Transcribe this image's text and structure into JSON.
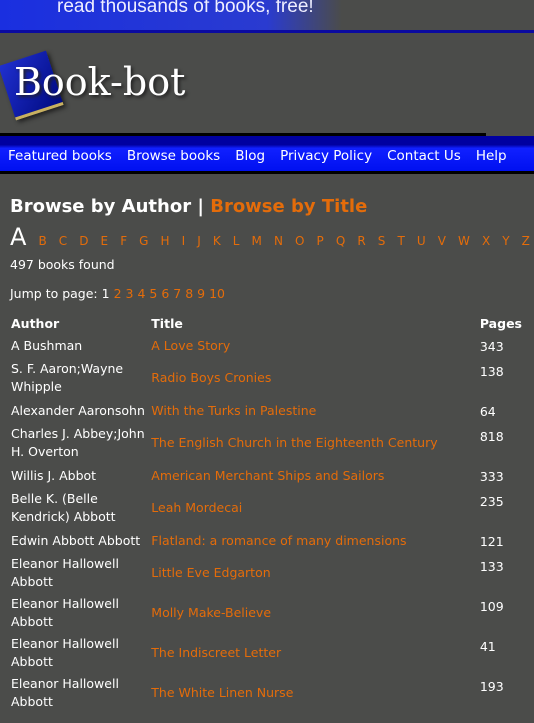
{
  "banner": {
    "tagline": "read thousands of books, free!"
  },
  "logo": {
    "text": "Book-bot"
  },
  "nav": [
    "Featured books",
    "Browse books",
    "Blog",
    "Privacy Policy",
    "Contact Us",
    "Help"
  ],
  "heading": {
    "author": "Browse by Author",
    "sep": "|",
    "title": "Browse by Title"
  },
  "alphabet": {
    "current": "A",
    "letters": [
      "B",
      "C",
      "D",
      "E",
      "F",
      "G",
      "H",
      "I",
      "J",
      "K",
      "L",
      "M",
      "N",
      "O",
      "P",
      "Q",
      "R",
      "S",
      "T",
      "U",
      "V",
      "W",
      "X",
      "Y",
      "Z"
    ]
  },
  "found": "497 books found",
  "jump": {
    "label": "Jump to page:",
    "current": "1",
    "pages": [
      "2",
      "3",
      "4",
      "5",
      "6",
      "7",
      "8",
      "9",
      "10"
    ]
  },
  "colors": {
    "background": "#4b4c4a",
    "accent": "#e46c0a",
    "nav": "#0010f0"
  },
  "table": {
    "headers": [
      "Author",
      "Title",
      "Pages"
    ],
    "rows": [
      {
        "author": "A Bushman",
        "title": "A Love Story",
        "pages": "343"
      },
      {
        "author": "S. F. Aaron;Wayne Whipple",
        "title": "Radio Boys Cronies",
        "pages": "138"
      },
      {
        "author": "Alexander Aaronsohn",
        "title": "With the Turks in Palestine",
        "pages": "64"
      },
      {
        "author": "Charles J. Abbey;John H. Overton",
        "title": "The English Church in the Eighteenth Century",
        "pages": "818"
      },
      {
        "author": "Willis J. Abbot",
        "title": "American Merchant Ships and Sailors",
        "pages": "333"
      },
      {
        "author": "Belle K. (Belle Kendrick) Abbott",
        "title": "Leah Mordecai",
        "pages": "235"
      },
      {
        "author": "Edwin Abbott Abbott",
        "title": "Flatland: a romance of many dimensions",
        "pages": "121"
      },
      {
        "author": "Eleanor Hallowell Abbott",
        "title": "Little Eve Edgarton",
        "pages": "133"
      },
      {
        "author": "Eleanor Hallowell Abbott",
        "title": "Molly Make-Believe",
        "pages": "109"
      },
      {
        "author": "Eleanor Hallowell Abbott",
        "title": "The Indiscreet Letter",
        "pages": "41"
      },
      {
        "author": "Eleanor Hallowell Abbott",
        "title": "The White Linen Nurse",
        "pages": "193"
      }
    ]
  }
}
